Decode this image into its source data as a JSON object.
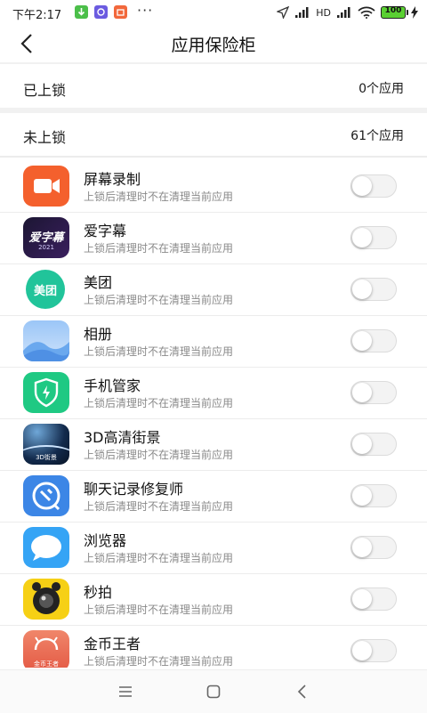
{
  "status_bar": {
    "time": "下午2:17",
    "overflow": "···",
    "net_label": "HD",
    "battery": "100"
  },
  "header": {
    "title": "应用保险柜"
  },
  "sections": {
    "locked": {
      "label": "已上锁",
      "count": "0个应用"
    },
    "unlocked": {
      "label": "未上锁",
      "count": "61个应用"
    }
  },
  "apps": [
    {
      "name": "屏幕录制",
      "desc": "上锁后清理时不在清理当前应用",
      "icon": "screen-record-icon",
      "locked": false
    },
    {
      "name": "爱字幕",
      "desc": "上锁后清理时不在清理当前应用",
      "icon": "aizimu-icon",
      "icon_text": "爱字幕",
      "icon_sub": "2021",
      "locked": false
    },
    {
      "name": "美团",
      "desc": "上锁后清理时不在清理当前应用",
      "icon": "meituan-icon",
      "icon_text": "美团",
      "locked": false
    },
    {
      "name": "相册",
      "desc": "上锁后清理时不在清理当前应用",
      "icon": "gallery-icon",
      "locked": false
    },
    {
      "name": "手机管家",
      "desc": "上锁后清理时不在清理当前应用",
      "icon": "phone-manager-icon",
      "locked": false
    },
    {
      "name": "3D高清街景",
      "desc": "上锁后清理时不在清理当前应用",
      "icon": "street-view-icon",
      "icon_text": "3D街景",
      "locked": false
    },
    {
      "name": "聊天记录修复师",
      "desc": "上锁后清理时不在清理当前应用",
      "icon": "chat-repair-icon",
      "locked": false
    },
    {
      "name": "浏览器",
      "desc": "上锁后清理时不在清理当前应用",
      "icon": "browser-icon",
      "locked": false
    },
    {
      "name": "秒拍",
      "desc": "上锁后清理时不在清理当前应用",
      "icon": "miaopai-icon",
      "locked": false
    },
    {
      "name": "金币王者",
      "desc": "上锁后清理时不在清理当前应用",
      "icon": "gold-king-icon",
      "icon_text": "金币王者",
      "locked": false
    }
  ],
  "colors": {
    "screen_record": "#f4602d",
    "meituan": "#21c49a",
    "phone_manager": "#1fc983",
    "chat_repair": "#3c86e6",
    "browser": "#35a4f5",
    "miaopai": "#f6d015"
  }
}
